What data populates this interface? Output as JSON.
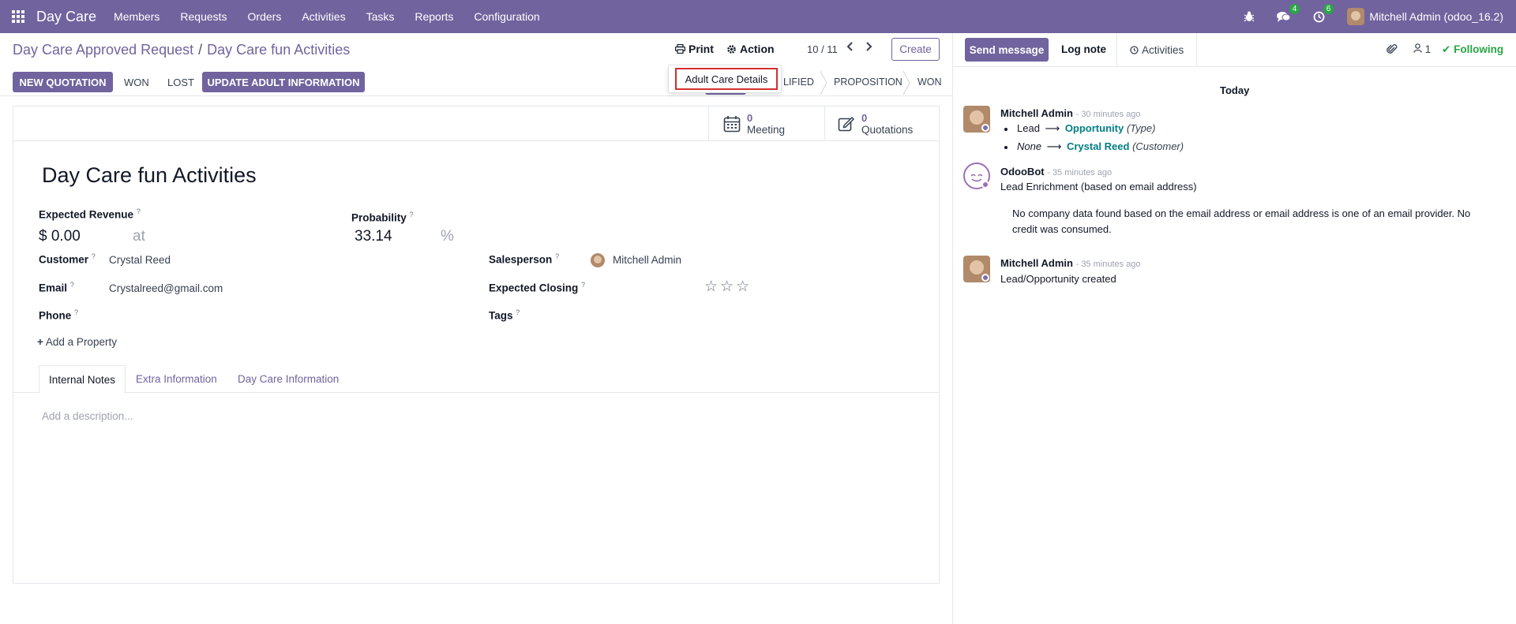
{
  "app": {
    "brand": "Day Care",
    "menu": [
      "Members",
      "Requests",
      "Orders",
      "Activities",
      "Tasks",
      "Reports",
      "Configuration"
    ],
    "messages_badge": "4",
    "activities_badge": "6",
    "user": "Mitchell Admin (odoo_16.2)"
  },
  "control": {
    "breadcrumb_parent": "Day Care Approved Request",
    "breadcrumb_sep": "/",
    "breadcrumb_current": "Day Care fun Activities",
    "print": "Print",
    "action": "Action",
    "pager": "10 / 11",
    "create": "Create",
    "dropdown_item": "Adult Care Details"
  },
  "statusbar": {
    "new_quotation": "NEW QUOTATION",
    "won": "WON",
    "lost": "LOST",
    "update_adult": "UPDATE ADULT INFORMATION",
    "stages": [
      "LIFIED",
      "PROPOSITION",
      "WON"
    ]
  },
  "stats": {
    "meeting_count": "0",
    "meeting_label": "Meeting",
    "quotation_count": "0",
    "quotation_label": "Quotations"
  },
  "form": {
    "title": "Day Care fun Activities",
    "expected_revenue_label": "Expected Revenue",
    "expected_revenue": "$ 0.00",
    "at": "at",
    "probability_label": "Probability",
    "probability": "33.14",
    "percent": "%",
    "customer_label": "Customer",
    "customer": "Crystal Reed",
    "email_label": "Email",
    "email": "Crystalreed@gmail.com",
    "phone_label": "Phone",
    "salesperson_label": "Salesperson",
    "salesperson": "Mitchell Admin",
    "expected_closing_label": "Expected Closing",
    "tags_label": "Tags",
    "help_mark": "?",
    "add_property": "Add a Property",
    "tabs": [
      "Internal Notes",
      "Extra Information",
      "Day Care Information"
    ],
    "description_placeholder": "Add a description...",
    "priority_stars": 0
  },
  "chatter": {
    "send_message": "Send message",
    "log_note": "Log note",
    "activities": "Activities",
    "followers_count": "1",
    "following": "Following",
    "today": "Today",
    "messages": [
      {
        "author": "Mitchell Admin",
        "time": "- 30 minutes ago",
        "tracking": [
          {
            "old": "Lead",
            "new": "Opportunity",
            "field": "(Type)"
          },
          {
            "old": "None",
            "new": "Crystal Reed",
            "field": "(Customer)"
          }
        ]
      },
      {
        "author": "OdooBot",
        "time": "- 35 minutes ago",
        "body": "Lead Enrichment (based on email address)",
        "body2_line1": "No company data found based on the email address or email address is one of an email provider. No",
        "body2_line2": "credit was consumed."
      },
      {
        "author": "Mitchell Admin",
        "time": "- 35 minutes ago",
        "body": "Lead/Opportunity created"
      }
    ]
  },
  "colors": {
    "primary": "#71639e",
    "badge_green": "#28a745",
    "highlight_red": "#d32f2f",
    "tracking_teal": "#017e84",
    "following_green": "#28a745"
  }
}
